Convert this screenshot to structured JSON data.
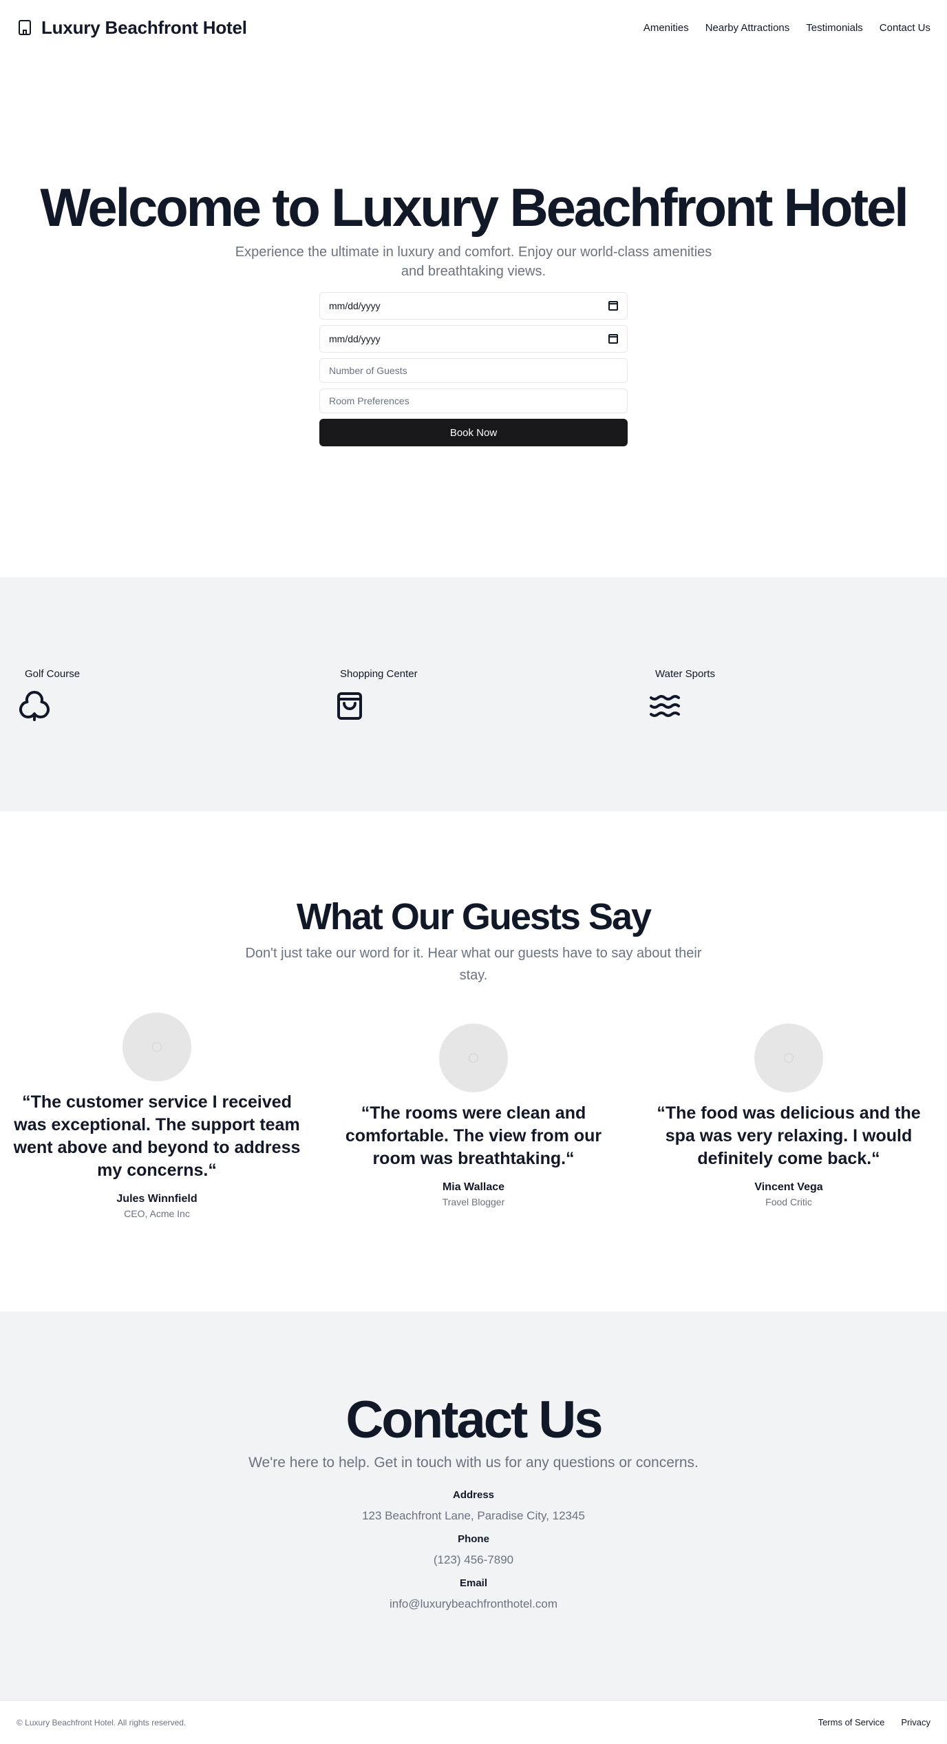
{
  "header": {
    "brand": "Luxury Beachfront Hotel",
    "logo_icon": "building-icon",
    "nav": [
      "Amenities",
      "Nearby Attractions",
      "Testimonials",
      "Contact Us"
    ]
  },
  "hero": {
    "title": "Welcome to Luxury Beachfront Hotel",
    "subtitle": "Experience the ultimate in luxury and comfort. Enjoy our world-class amenities and breathtaking views.",
    "checkin_value": "mm/dd/yyyy",
    "checkout_value": "mm/dd/yyyy",
    "guests_placeholder": "Number of Guests",
    "preferences_placeholder": "Room Preferences",
    "book_label": "Book Now"
  },
  "amenities": [
    {
      "label": "Golf Course",
      "icon": "club-icon"
    },
    {
      "label": "Shopping Center",
      "icon": "shopping-bag-icon"
    },
    {
      "label": "Water Sports",
      "icon": "waves-icon"
    }
  ],
  "testimonials": {
    "title": "What Our Guests Say",
    "subtitle": "Don't just take our word for it. Hear what our guests have to say about their stay.",
    "items": [
      {
        "quote": "“The customer service I received was exceptional. The support team went above and beyond to address my concerns.“",
        "name": "Jules Winnfield",
        "role": "CEO, Acme Inc"
      },
      {
        "quote": "“The rooms were clean and comfortable. The view from our room was breathtaking.“",
        "name": "Mia Wallace",
        "role": "Travel Blogger"
      },
      {
        "quote": "“The food was delicious and the spa was very relaxing. I would definitely come back.“",
        "name": "Vincent Vega",
        "role": "Food Critic"
      }
    ]
  },
  "contact": {
    "title": "Contact Us",
    "subtitle": "We're here to help. Get in touch with us for any questions or concerns.",
    "address_label": "Address",
    "address": "123 Beachfront Lane, Paradise City, 12345",
    "phone_label": "Phone",
    "phone": "(123) 456-7890",
    "email_label": "Email",
    "email": "info@luxurybeachfronthotel.com"
  },
  "footer": {
    "copyright": "© Luxury Beachfront Hotel. All rights reserved.",
    "links": [
      "Terms of Service",
      "Privacy"
    ]
  },
  "colors": {
    "text": "#111827",
    "muted": "#6b7280",
    "section_bg": "#f2f3f5",
    "button_bg": "#18181b"
  }
}
